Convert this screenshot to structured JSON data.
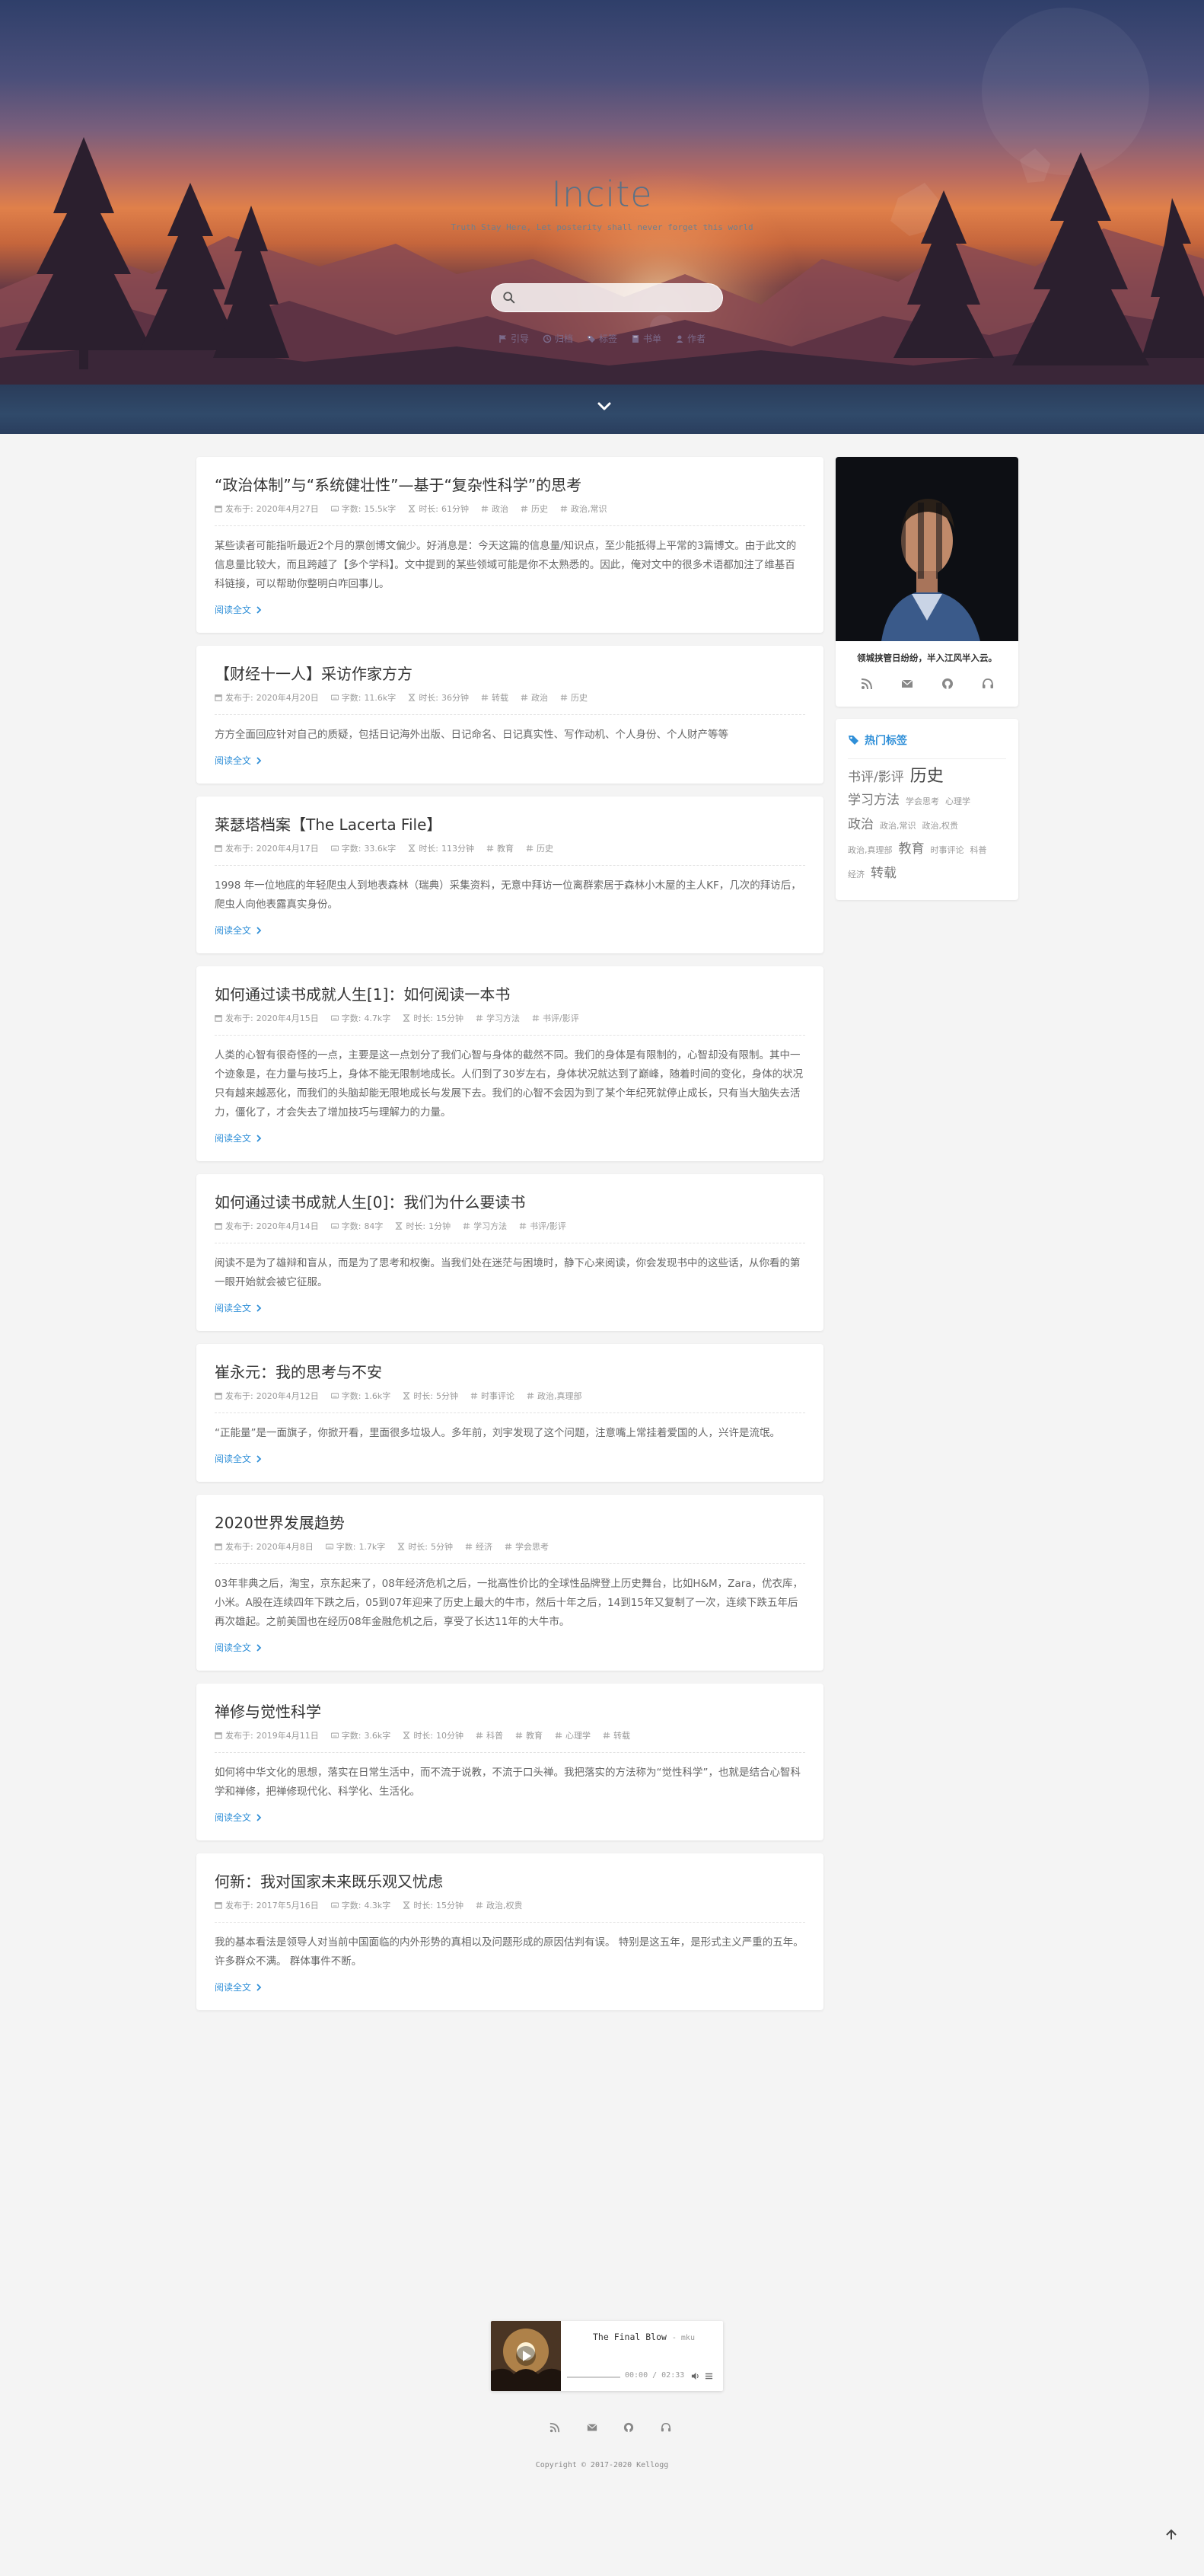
{
  "site": {
    "title": "Incite",
    "subtitle": "Truth Stay Here, Let posterity shall never forget this world",
    "search_placeholder": ""
  },
  "nav": [
    {
      "icon": "flag-icon",
      "label": "引导"
    },
    {
      "icon": "archive-icon",
      "label": "归档"
    },
    {
      "icon": "tags-icon",
      "label": "标签"
    },
    {
      "icon": "book-icon",
      "label": "书单"
    },
    {
      "icon": "user-icon",
      "label": "作者"
    }
  ],
  "meta_labels": {
    "published": "发布于:",
    "words": "字数:",
    "duration": "时长:"
  },
  "posts": [
    {
      "title": "“政治体制”与“系统健壮性”—基于“复杂性科学”的思考",
      "date": "2020年4月27日",
      "words": "15.5k字",
      "duration": "61分钟",
      "tags": [
        "政治",
        "历史",
        "政治,常识"
      ],
      "excerpt": "某些读者可能指听最近2个月的票创博文偏少。好消息是：今天这篇的信息量/知识点，至少能抵得上平常的3篇博文。由于此文的信息量比较大，而且跨越了【多个学科】。文中提到的某些领域可能是你不太熟悉的。因此，俺对文中的很多术语都加注了维基百科链接，可以帮助你整明白咋回事儿。",
      "more": "阅读全文"
    },
    {
      "title": "【财经十一人】采访作家方方",
      "date": "2020年4月20日",
      "words": "11.6k字",
      "duration": "36分钟",
      "tags": [
        "转载",
        "政治",
        "历史"
      ],
      "excerpt": "方方全面回应针对自己的质疑，包括日记海外出版、日记命名、日记真实性、写作动机、个人身份、个人财产等等",
      "more": "阅读全文"
    },
    {
      "title": "莱瑟塔档案【The Lacerta File】",
      "date": "2020年4月17日",
      "words": "33.6k字",
      "duration": "113分钟",
      "tags": [
        "教育",
        "历史"
      ],
      "excerpt": "1998 年一位地底的年轻爬虫人到地表森林（瑞典）采集资料，无意中拜访一位离群索居于森林小木屋的主人KF，几次的拜访后，爬虫人向他表露真实身份。",
      "more": "阅读全文"
    },
    {
      "title": "如何通过读书成就人生[1]：如何阅读一本书",
      "date": "2020年4月15日",
      "words": "4.7k字",
      "duration": "15分钟",
      "tags": [
        "学习方法",
        "书评/影评"
      ],
      "excerpt": "人类的心智有很奇怪的一点，主要是这一点划分了我们心智与身体的截然不同。我们的身体是有限制的，心智却没有限制。其中一个迹象是，在力量与技巧上，身体不能无限制地成长。人们到了30岁左右，身体状况就达到了巅峰，随着时间的变化，身体的状况只有越来越恶化，而我们的头脑却能无限地成长与发展下去。我们的心智不会因为到了某个年纪死就停止成长，只有当大脑失去活力，僵化了，才会失去了增加技巧与理解力的力量。",
      "more": "阅读全文"
    },
    {
      "title": "如何通过读书成就人生[0]：我们为什么要读书",
      "date": "2020年4月14日",
      "words": "84字",
      "duration": "1分钟",
      "tags": [
        "学习方法",
        "书评/影评"
      ],
      "excerpt": "阅读不是为了雄辩和盲从，而是为了思考和权衡。当我们处在迷茫与困境时，静下心来阅读，你会发现书中的这些话，从你看的第一眼开始就会被它征服。",
      "more": "阅读全文"
    },
    {
      "title": "崔永元：我的思考与不安",
      "date": "2020年4月12日",
      "words": "1.6k字",
      "duration": "5分钟",
      "tags": [
        "时事评论",
        "政治,真理部"
      ],
      "excerpt": "“正能量”是一面旗子，你掀开看，里面很多垃圾人。多年前，刘宇发现了这个问题，注意嘴上常挂着爱国的人，兴许是流氓。",
      "more": "阅读全文"
    },
    {
      "title": "2020世界发展趋势",
      "date": "2020年4月8日",
      "words": "1.7k字",
      "duration": "5分钟",
      "tags": [
        "经济",
        "学会思考"
      ],
      "excerpt": "03年非典之后，淘宝，京东起来了，08年经济危机之后，一批高性价比的全球性品牌登上历史舞台，比如H&M，Zara，优衣库，小米。A股在连续四年下跌之后，05到07年迎来了历史上最大的牛市，然后十年之后，14到15年又复制了一次，连续下跌五年后再次雄起。之前美国也在经历08年金融危机之后，享受了长达11年的大牛市。",
      "more": "阅读全文"
    },
    {
      "title": "禅修与觉性科学",
      "date": "2019年4月11日",
      "words": "3.6k字",
      "duration": "10分钟",
      "tags": [
        "科普",
        "教育",
        "心理学",
        "转载"
      ],
      "excerpt": "如何将中华文化的思想，落实在日常生活中，而不流于说教，不流于口头禅。我把落实的方法称为“觉性科学”，也就是结合心智科学和禅修，把禅修现代化、科学化、生活化。",
      "more": "阅读全文"
    },
    {
      "title": "何新：我对国家未来既乐观又忧虑",
      "date": "2017年5月16日",
      "words": "4.3k字",
      "duration": "15分钟",
      "tags": [
        "政治,权贵"
      ],
      "excerpt": "我的基本看法是领导人对当前中国面临的内外形势的真相以及问题形成的原因估判有误。 特别是这五年，是形式主义严重的五年。 许多群众不满。 群体事件不断。",
      "more": "阅读全文"
    }
  ],
  "sidebar": {
    "motto": "领城挟管日纷纷，半入江风半入云。",
    "social": [
      "rss-icon",
      "mail-icon",
      "github-icon",
      "headphones-icon"
    ],
    "tags_title": "热门标签",
    "tags": [
      {
        "name": "书评/影评",
        "size": 17
      },
      {
        "name": "历史",
        "size": 22
      },
      {
        "name": "学习方法",
        "size": 17
      },
      {
        "name": "学会思考",
        "size": 11
      },
      {
        "name": "心理学",
        "size": 11
      },
      {
        "name": "政治",
        "size": 17
      },
      {
        "name": "政治,常识",
        "size": 11
      },
      {
        "name": "政治,权贵",
        "size": 11
      },
      {
        "name": "政治,真理部",
        "size": 11
      },
      {
        "name": "教育",
        "size": 17
      },
      {
        "name": "时事评论",
        "size": 11
      },
      {
        "name": "科普",
        "size": 11
      },
      {
        "name": "经济",
        "size": 11
      },
      {
        "name": "转载",
        "size": 17
      }
    ]
  },
  "player": {
    "title": "The Final Blow",
    "artist": "- mku",
    "time": "00:00 / 02:33",
    "progress": 0
  },
  "footer": {
    "copyright": "Copyright © 2017-2020 Kellogg"
  }
}
